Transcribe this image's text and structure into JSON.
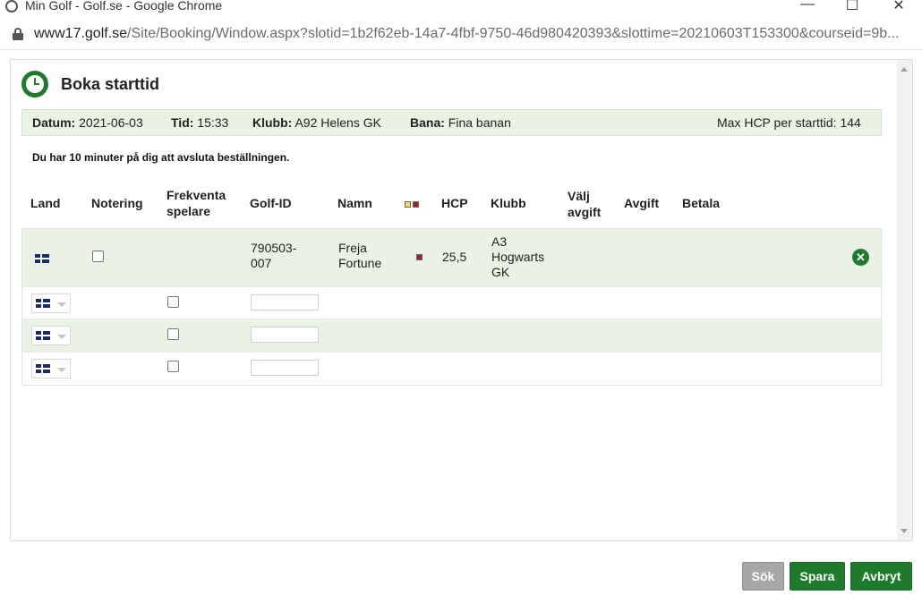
{
  "window": {
    "title": "Min Golf - Golf.se - Google Chrome",
    "minimize": "—",
    "maximize": "☐",
    "close": "✕"
  },
  "address": {
    "host": "www17.golf.se",
    "path": "/Site/Booking/Window.aspx?slotid=1b2f62eb-14a7-4fbf-9750-46d980420393&slottime=20210603T153300&courseid=9b..."
  },
  "page": {
    "title": "Boka starttid",
    "notice": "Du har 10 minuter på dig att avsluta beställningen."
  },
  "info": {
    "date_label": "Datum:",
    "date": "2021-06-03",
    "time_label": "Tid:",
    "time": "15:33",
    "club_label": "Klubb:",
    "club": "A92 Helens GK",
    "course_label": "Bana:",
    "course": "Fina banan",
    "max_hcp": "Max HCP per starttid: 144"
  },
  "table": {
    "headers": {
      "land": "Land",
      "notering": "Notering",
      "frekventa": "Frekventa spelare",
      "golfid": "Golf-ID",
      "namn": "Namn",
      "hcp": "HCP",
      "klubb": "Klubb",
      "valj_avgift": "Välj avgift",
      "avgift": "Avgift",
      "betala": "Betala"
    },
    "player": {
      "golf_id": "790503-007",
      "name": "Freja Fortune",
      "hcp": "25,5",
      "club": "A3 Hogwarts GK"
    },
    "tee_colors": [
      "#f5e04a",
      "#a0202a"
    ],
    "player_tee_color": "#a0202a",
    "empty_rows": 3
  },
  "buttons": {
    "search": "Sök",
    "save": "Spara",
    "cancel": "Avbryt"
  },
  "colors": {
    "accent": "#1e7b2e",
    "row_tint": "#eaf2e6",
    "disabled": "#a7a7a7"
  }
}
